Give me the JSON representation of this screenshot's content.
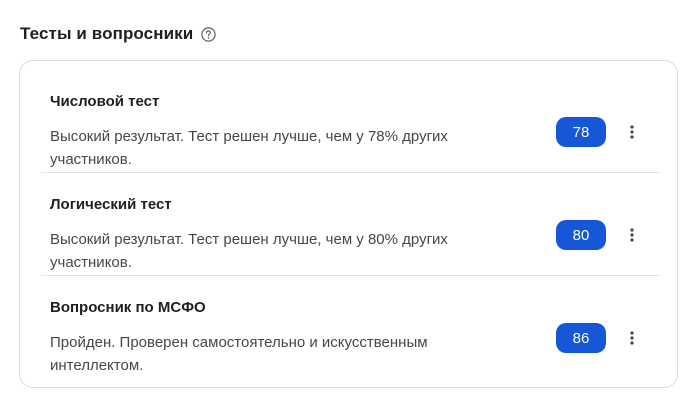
{
  "section": {
    "title": "Тесты и вопросники"
  },
  "icons": {
    "help": "question-circle-icon",
    "menu": "more-vertical-icon"
  },
  "colors": {
    "badge": "#1557d6",
    "text_primary": "#1f1f1f",
    "text_secondary": "#474747"
  },
  "tests": [
    {
      "title": "Числовой тест",
      "description": "Высокий результат. Тест решен лучше, чем у 78% других участников.",
      "score": "78"
    },
    {
      "title": "Логический тест",
      "description": "Высокий результат. Тест решен лучше, чем у 80% других участников.",
      "score": "80"
    },
    {
      "title": "Вопросник по МСФО",
      "description": "Пройден. Проверен самостоятельно и искусственным интеллектом.",
      "score": "86"
    }
  ]
}
